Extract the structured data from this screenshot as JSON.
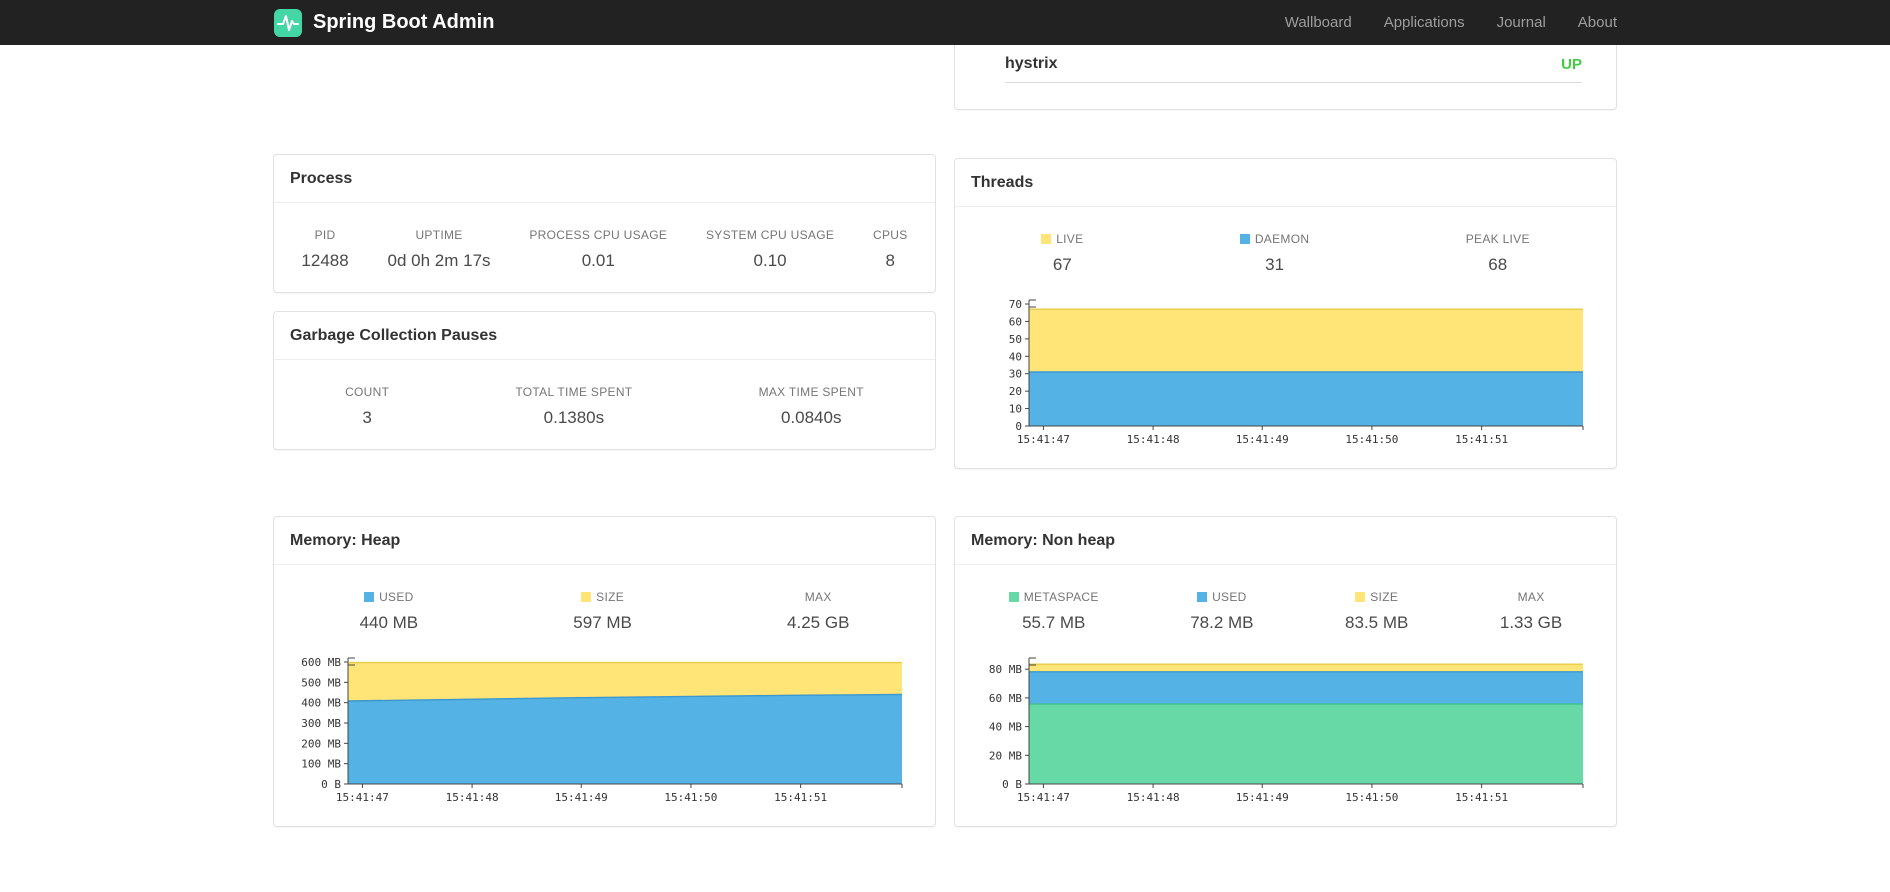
{
  "navbar": {
    "brand": "Spring Boot Admin",
    "items": [
      {
        "label": "Wallboard"
      },
      {
        "label": "Applications"
      },
      {
        "label": "Journal"
      },
      {
        "label": "About"
      }
    ]
  },
  "application_row": {
    "name": "hystrix",
    "status": "UP"
  },
  "colors": {
    "status_up": "#41cc41",
    "navbar_bg": "#222222",
    "brand_icon": "#45d6a6",
    "yellow": "#ffe478",
    "yellow_stroke": "#e8cb4a",
    "blue": "#55b2e5",
    "blue_stroke": "#3b98cf",
    "green": "#67d9a7",
    "green_stroke": "#41c28b"
  },
  "cards": {
    "process": {
      "title": "Process",
      "stats": [
        {
          "label": "PID",
          "value": "12488"
        },
        {
          "label": "UPTIME",
          "value": "0d 0h 2m 17s"
        },
        {
          "label": "PROCESS CPU USAGE",
          "value": "0.01"
        },
        {
          "label": "SYSTEM CPU USAGE",
          "value": "0.10"
        },
        {
          "label": "CPUS",
          "value": "8"
        }
      ]
    },
    "gc": {
      "title": "Garbage Collection Pauses",
      "stats": [
        {
          "label": "COUNT",
          "value": "3"
        },
        {
          "label": "TOTAL TIME SPENT",
          "value": "0.1380s"
        },
        {
          "label": "MAX TIME SPENT",
          "value": "0.0840s"
        }
      ]
    },
    "threads": {
      "title": "Threads",
      "stats": [
        {
          "label": "LIVE",
          "value": "67",
          "swatch": "yellow"
        },
        {
          "label": "DAEMON",
          "value": "31",
          "swatch": "blue"
        },
        {
          "label": "PEAK LIVE",
          "value": "68"
        }
      ]
    },
    "heap": {
      "title": "Memory: Heap",
      "stats": [
        {
          "label": "USED",
          "value": "440 MB",
          "swatch": "blue"
        },
        {
          "label": "SIZE",
          "value": "597 MB",
          "swatch": "yellow"
        },
        {
          "label": "MAX",
          "value": "4.25 GB"
        }
      ]
    },
    "nonheap": {
      "title": "Memory: Non heap",
      "stats": [
        {
          "label": "METASPACE",
          "value": "55.7 MB",
          "swatch": "green"
        },
        {
          "label": "USED",
          "value": "78.2 MB",
          "swatch": "blue"
        },
        {
          "label": "SIZE",
          "value": "83.5 MB",
          "swatch": "yellow"
        },
        {
          "label": "MAX",
          "value": "1.33 GB"
        }
      ]
    }
  },
  "chart_data": [
    {
      "id": "threads",
      "type": "area",
      "title": "Threads",
      "x": [
        "15:41:47",
        "15:41:48",
        "15:41:49",
        "15:41:50",
        "15:41:51"
      ],
      "ylim": [
        0,
        70
      ],
      "yticks": [
        {
          "v": 0,
          "label": "0"
        },
        {
          "v": 10,
          "label": "10"
        },
        {
          "v": 20,
          "label": "20"
        },
        {
          "v": 30,
          "label": "30"
        },
        {
          "v": 40,
          "label": "40"
        },
        {
          "v": 50,
          "label": "50"
        },
        {
          "v": 60,
          "label": "60"
        },
        {
          "v": 70,
          "label": "70"
        }
      ],
      "series": [
        {
          "name": "LIVE",
          "color_key": "yellow",
          "values": [
            67,
            67,
            67,
            67,
            67,
            67
          ]
        },
        {
          "name": "DAEMON",
          "color_key": "blue",
          "values": [
            31,
            31,
            31,
            31,
            31,
            31
          ]
        }
      ],
      "legend_position": "top",
      "grid": false
    },
    {
      "id": "heap",
      "type": "area",
      "title": "Memory: Heap",
      "x": [
        "15:41:47",
        "15:41:48",
        "15:41:49",
        "15:41:50",
        "15:41:51"
      ],
      "ylim": [
        0,
        600
      ],
      "yticks": [
        {
          "v": 0,
          "label": "0 B"
        },
        {
          "v": 100,
          "label": "100 MB"
        },
        {
          "v": 200,
          "label": "200 MB"
        },
        {
          "v": 300,
          "label": "300 MB"
        },
        {
          "v": 400,
          "label": "400 MB"
        },
        {
          "v": 500,
          "label": "500 MB"
        },
        {
          "v": 600,
          "label": "600 MB"
        }
      ],
      "series": [
        {
          "name": "SIZE",
          "color_key": "yellow",
          "values": [
            597,
            597,
            597,
            597,
            597,
            597
          ]
        },
        {
          "name": "USED",
          "color_key": "blue",
          "values": [
            408,
            416,
            424,
            430,
            436,
            440
          ]
        }
      ],
      "legend_position": "top",
      "grid": false
    },
    {
      "id": "nonheap",
      "type": "area",
      "title": "Memory: Non heap",
      "x": [
        "15:41:47",
        "15:41:48",
        "15:41:49",
        "15:41:50",
        "15:41:51"
      ],
      "ylim": [
        0,
        85
      ],
      "yticks": [
        {
          "v": 0,
          "label": "0 B"
        },
        {
          "v": 20,
          "label": "20 MB"
        },
        {
          "v": 40,
          "label": "40 MB"
        },
        {
          "v": 60,
          "label": "60 MB"
        },
        {
          "v": 80,
          "label": "80 MB"
        }
      ],
      "series": [
        {
          "name": "SIZE",
          "color_key": "yellow",
          "values": [
            83.5,
            83.5,
            83.5,
            83.5,
            83.5,
            83.5
          ]
        },
        {
          "name": "USED",
          "color_key": "blue",
          "values": [
            78.2,
            78.2,
            78.2,
            78.2,
            78.2,
            78.2
          ]
        },
        {
          "name": "METASPACE",
          "color_key": "green",
          "values": [
            55.7,
            55.7,
            55.7,
            55.7,
            55.7,
            55.7
          ]
        }
      ],
      "legend_position": "top",
      "grid": false
    }
  ]
}
